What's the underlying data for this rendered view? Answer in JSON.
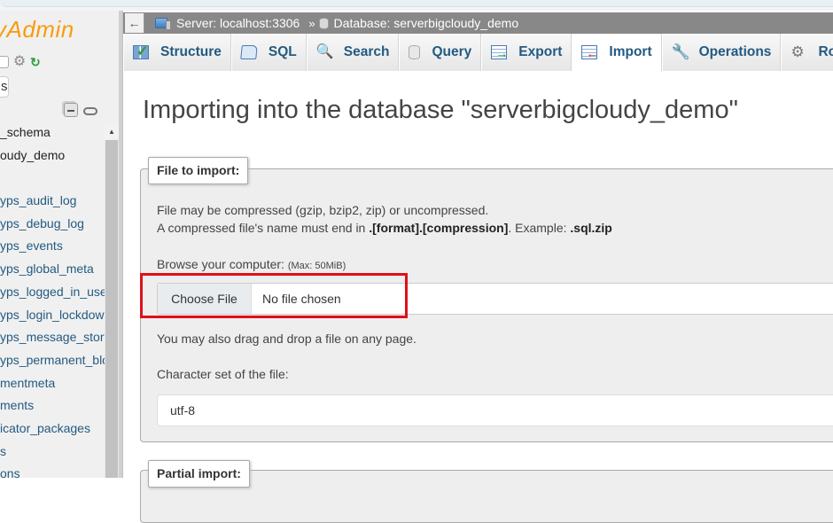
{
  "sidebar": {
    "logo_text": "yAdmin",
    "recent_label": "s",
    "tree_items": [
      {
        "label": "_schema",
        "dark": true
      },
      {
        "label": "oudy_demo",
        "dark": true
      },
      {
        "label": "",
        "dark": false
      },
      {
        "label": "yps_audit_log",
        "dark": false
      },
      {
        "label": "yps_debug_log",
        "dark": false
      },
      {
        "label": "yps_events",
        "dark": false
      },
      {
        "label": "yps_global_meta",
        "dark": false
      },
      {
        "label": "yps_logged_in_users",
        "dark": false
      },
      {
        "label": "yps_login_lockdown",
        "dark": false
      },
      {
        "label": "yps_message_store",
        "dark": false
      },
      {
        "label": "yps_permanent_block",
        "dark": false
      },
      {
        "label": "mentmeta",
        "dark": false
      },
      {
        "label": "ments",
        "dark": false
      },
      {
        "label": "icator_packages",
        "dark": false
      },
      {
        "label": "s",
        "dark": false
      },
      {
        "label": "ons",
        "dark": false
      }
    ]
  },
  "breadcrumb": {
    "back_label": "←",
    "server_label": "Server: localhost:3306",
    "separator": "»",
    "database_label": "Database: serverbigcloudy_demo"
  },
  "tabs": [
    {
      "label": "Structure",
      "icon": "structure-icon",
      "active": false
    },
    {
      "label": "SQL",
      "icon": "sql-icon",
      "active": false
    },
    {
      "label": "Search",
      "icon": "search-icon",
      "active": false
    },
    {
      "label": "Query",
      "icon": "query-icon",
      "active": false
    },
    {
      "label": "Export",
      "icon": "export-icon",
      "active": false
    },
    {
      "label": "Import",
      "icon": "import-icon",
      "active": true
    },
    {
      "label": "Operations",
      "icon": "operations-icon",
      "active": false
    },
    {
      "label": "Rout",
      "icon": "routines-icon",
      "active": false
    }
  ],
  "page": {
    "title": "Importing into the database \"serverbigcloudy_demo\""
  },
  "file_to_import": {
    "legend": "File to import:",
    "line1": "File may be compressed (gzip, bzip2, zip) or uncompressed.",
    "line2_prefix": "A compressed file's name must end in ",
    "line2_bold1": ".[format].[compression]",
    "line2_mid": ". Example: ",
    "line2_bold2": ".sql.zip",
    "browse_label": "Browse your computer: ",
    "browse_max": "(Max: 50MiB)",
    "choose_file_button": "Choose File",
    "no_file_text": "No file chosen",
    "drag_drop_text": "You may also drag and drop a file on any page.",
    "charset_label": "Character set of the file:",
    "charset_value": "utf-8"
  },
  "partial_import": {
    "legend": "Partial import:"
  },
  "colors": {
    "accent": "#235a81",
    "logo": "#f89c0e",
    "highlight": "#e0101a",
    "breadcrumb_bg": "#888888"
  }
}
